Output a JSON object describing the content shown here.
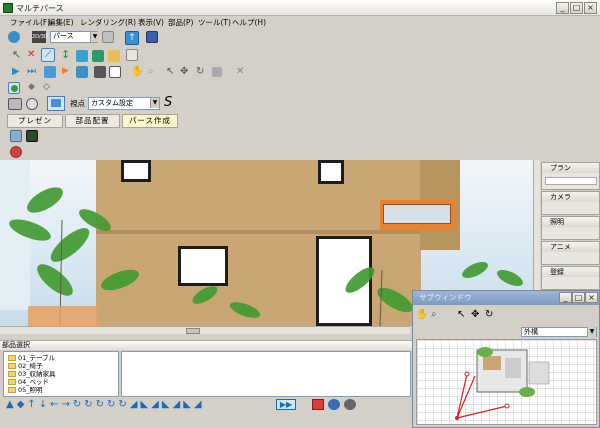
{
  "window": {
    "title": "マルチパース",
    "buttons": [
      "_",
      "□",
      "×"
    ]
  },
  "menu": [
    "ファイル(F)",
    "編集(E)",
    "レンダリング(R)",
    "表示(V)",
    "部品(P)",
    "ツール(T)",
    "ヘルプ(H)"
  ],
  "toolbar": {
    "view_select": {
      "prefix": "2D/3D",
      "value": "パース"
    },
    "viewpoint_label": "視点",
    "viewpoint_select": "カスタム設定",
    "s_label": "S"
  },
  "tabs": [
    "プレゼン",
    "部品配置",
    "パース作成"
  ],
  "right_panels": [
    "プラン",
    "カメラ",
    "照明",
    "アニメ",
    "登録"
  ],
  "parts": {
    "header": "部品選択",
    "items": [
      "01_テーブル",
      "02_椅子",
      "03_収納家具",
      "04_ベッド",
      "05_照明"
    ]
  },
  "subwindow": {
    "title": "サブウィンドウ",
    "select": "外構",
    "buttons": [
      "_",
      "□",
      "×"
    ]
  },
  "colors": {
    "sky": "#e4eef5",
    "wall": "#c9a674",
    "accent": "#e9822a",
    "selection": "#cfe6f7"
  }
}
